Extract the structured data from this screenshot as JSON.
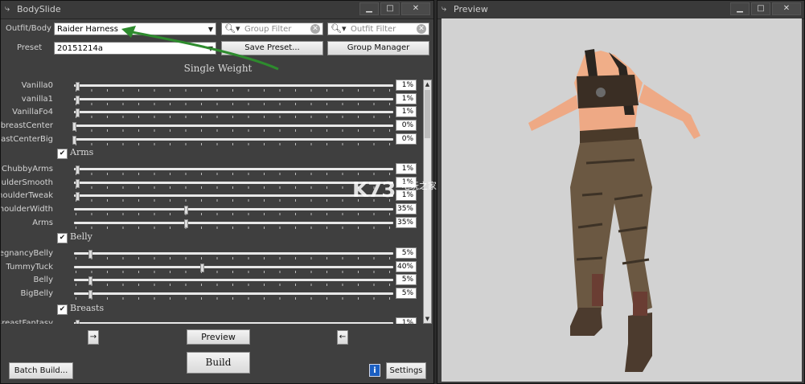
{
  "bodyslide": {
    "title": "BodySlide",
    "outfit_label": "Outfit/Body",
    "outfit_value": "Raider Harness",
    "preset_label": "Preset",
    "preset_value": "20151214a",
    "group_filter_placeholder": "Group Filter",
    "outfit_filter_placeholder": "Outfit Filter",
    "save_preset": "Save Preset...",
    "group_manager": "Group Manager",
    "section_title": "Single Weight",
    "sliders": [
      {
        "name": "Vanilla0",
        "value": "1%"
      },
      {
        "name": "vanilla1",
        "value": "1%"
      },
      {
        "name": "VanillaFo4",
        "value": "1%"
      },
      {
        "name": "breastCenter",
        "value": "0%"
      },
      {
        "name": "breastCenterBig",
        "value": "0%"
      },
      {
        "group": "Arms"
      },
      {
        "name": "ChubbyArms",
        "value": "1%"
      },
      {
        "name": "ShoulderSmooth",
        "value": "1%"
      },
      {
        "name": "ShoulderTweak",
        "value": "1%"
      },
      {
        "name": "ShoulderWidth",
        "value": "35%"
      },
      {
        "name": "Arms",
        "value": "35%"
      },
      {
        "group": "Belly"
      },
      {
        "name": "PregnancyBelly",
        "value": "5%"
      },
      {
        "name": "TummyTuck",
        "value": "40%"
      },
      {
        "name": "Belly",
        "value": "5%"
      },
      {
        "name": "BigBelly",
        "value": "5%"
      },
      {
        "group": "Breasts"
      },
      {
        "name": "BreastFantasy",
        "value": "1%"
      }
    ],
    "arrow_left": "→",
    "arrow_right": "←",
    "preview_button": "Preview",
    "build_button": "Build",
    "batch_build": "Batch Build...",
    "info_glyph": "i",
    "settings": "Settings"
  },
  "preview": {
    "title": "Preview"
  },
  "watermark": {
    "logo": "K73",
    "text": "电玩之家"
  },
  "colors": {
    "window_bg": "#3f3f3f",
    "viewport_bg": "#d2d2d2",
    "annotation_arrow": "#2e8b2e"
  }
}
